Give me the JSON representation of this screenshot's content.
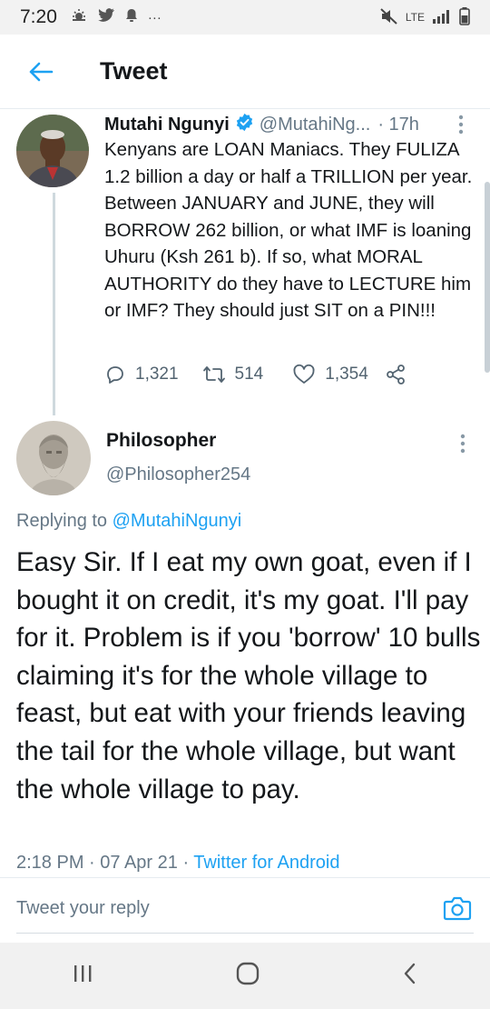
{
  "status_bar": {
    "time": "7:20",
    "notification_icons": [
      "weather-icon",
      "twitter-icon",
      "bell-icon",
      "more-icon"
    ],
    "more": "···",
    "network": "LTE",
    "icons": [
      "mute-icon",
      "signal-icon",
      "battery-icon"
    ]
  },
  "app_bar": {
    "title": "Tweet"
  },
  "parent_tweet": {
    "name": "Mutahi Ngunyi",
    "handle": "@MutahiNg...",
    "time": "· 17h",
    "text": "Kenyans are LOAN Maniacs. They FULIZA 1.2 billion a day or half a TRILLION per year. Between JANUARY and JUNE, they will BORROW 262 billion, or what IMF is loaning Uhuru (Ksh 261 b). If so, what MORAL AUTHORITY do they have to LECTURE him or IMF? They should just SIT on a PIN!!!",
    "replies": "1,321",
    "retweets": "514",
    "likes": "1,354"
  },
  "reply_tweet": {
    "name": "Philosopher",
    "handle": "@Philosopher254",
    "replying_prefix": "Replying to",
    "replying_to": "@MutahiNgunyi",
    "text": "Easy Sir. If I eat my own goat, even if I bought it on credit, it's my goat. I'll pay for it. Problem is if you 'borrow' 10 bulls claiming it's for the whole village to feast, but eat with your friends leaving the tail for the whole village, but want the whole village to pay.",
    "timestamp": "2:18 PM · 07 Apr 21 · ",
    "source": "Twitter for Android"
  },
  "composer": {
    "placeholder": "Tweet your reply"
  },
  "colors": {
    "accent": "#1da1f2",
    "text": "#14171a",
    "muted": "#657786"
  }
}
